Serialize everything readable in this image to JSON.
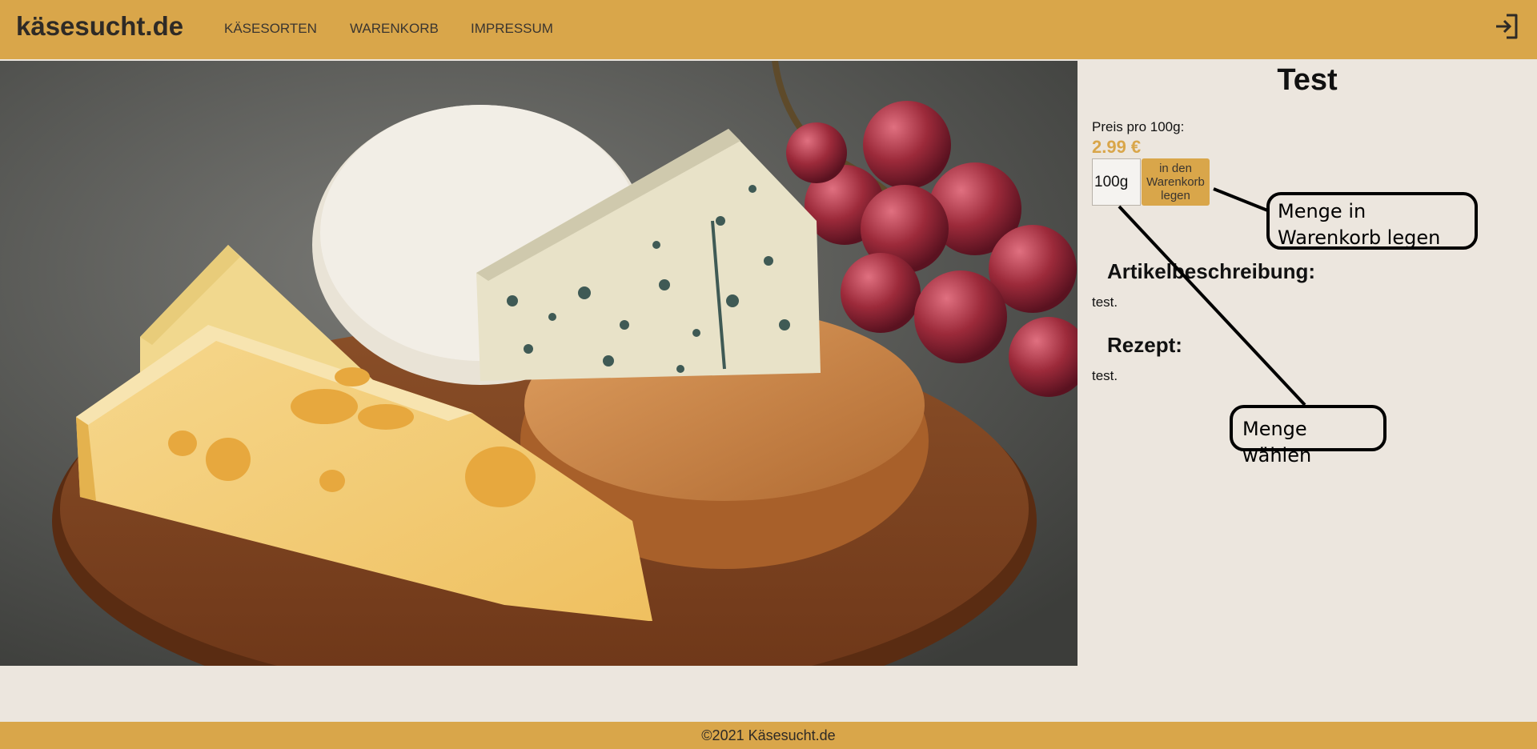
{
  "header": {
    "logo": "käsesucht.de",
    "nav": [
      {
        "label": "KÄSESORTEN"
      },
      {
        "label": "WARENKORB"
      },
      {
        "label": "IMPRESSUM"
      }
    ],
    "login_icon": "login-icon"
  },
  "hero": {
    "image": "cheese-platter-photo",
    "alt_description": ""
  },
  "product": {
    "title": "Test",
    "price_label": "Preis pro 100g:",
    "price_value": "2.99 €",
    "quantity_value": "100g",
    "add_to_cart_label": "in den Warenkorb legen",
    "description_heading": "Artikelbeschreibung:",
    "description_text": "test.",
    "recipe_heading": "Rezept:",
    "recipe_text": "test."
  },
  "annotations": {
    "cart_callout": "Menge in Warenkorb legen",
    "quantity_callout": "Menge wählen"
  },
  "footer": {
    "copyright": "©2021 Käsesucht.de"
  },
  "colors": {
    "accent": "#d9a64a",
    "background": "#ece6de",
    "text_dark": "#2e2a26"
  }
}
